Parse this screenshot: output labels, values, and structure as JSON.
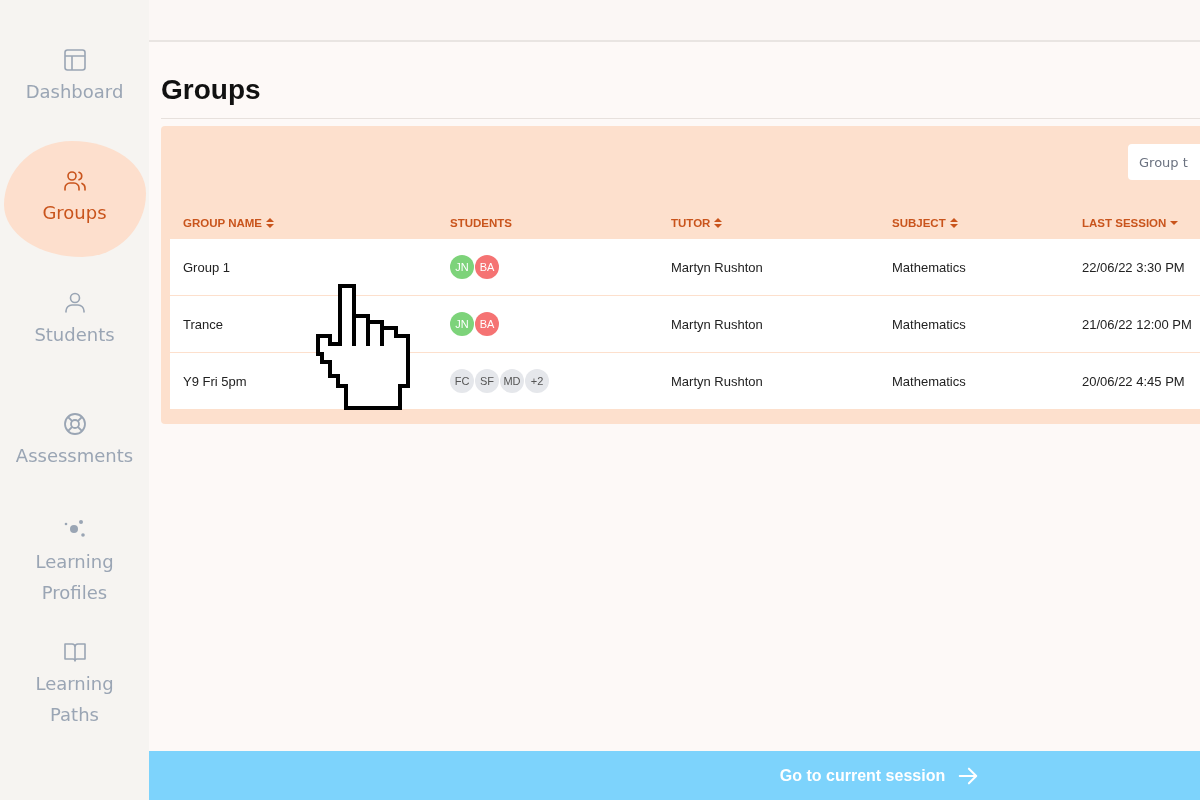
{
  "sidebar": {
    "items": [
      {
        "label": "Dashboard",
        "kind": "dashboard",
        "selected": false
      },
      {
        "label": "Groups",
        "kind": "groups",
        "selected": true
      },
      {
        "label": "Students",
        "kind": "student",
        "selected": false
      },
      {
        "label": "Assessments",
        "kind": "lifebuoy",
        "selected": false
      },
      {
        "label": "Learning Profiles",
        "kind": "dots",
        "selected": false
      },
      {
        "label": "Learning Paths",
        "kind": "book",
        "selected": false
      }
    ]
  },
  "page": {
    "title": "Groups"
  },
  "filter": {
    "placeholder": "Group t"
  },
  "table": {
    "columns": [
      {
        "label": "GROUP NAME",
        "kind": "sortable"
      },
      {
        "label": "STUDENTS",
        "kind": "plain"
      },
      {
        "label": "TUTOR",
        "kind": "sortable"
      },
      {
        "label": "SUBJECT",
        "kind": "sortable"
      },
      {
        "label": "LAST SESSION",
        "kind": "sorted"
      }
    ],
    "rows": [
      {
        "name": "Group 1",
        "students": [
          {
            "initials": "JN",
            "color": "#7dd37a"
          },
          {
            "initials": "BA",
            "color": "#f57373"
          }
        ],
        "tutor": "Martyn Rushton",
        "subject": "Mathematics",
        "last_session": "22/06/22 3:30 PM"
      },
      {
        "name": "Trance",
        "students": [
          {
            "initials": "JN",
            "color": "#7dd37a"
          },
          {
            "initials": "BA",
            "color": "#f57373"
          }
        ],
        "tutor": "Martyn Rushton",
        "subject": "Mathematics",
        "last_session": "21/06/22 12:00 PM"
      },
      {
        "name": "Y9 Fri 5pm",
        "students": [
          {
            "initials": "FC",
            "color": "#e5e7eb"
          },
          {
            "initials": "SF",
            "color": "#e5e7eb"
          },
          {
            "initials": "MD",
            "color": "#e5e7eb"
          },
          {
            "initials": "+2",
            "color": "#e5e7eb"
          }
        ],
        "tutor": "Martyn Rushton",
        "subject": "Mathematics",
        "last_session": "20/06/22 4:45 PM"
      }
    ]
  },
  "footer": {
    "action": "Go to current session"
  }
}
